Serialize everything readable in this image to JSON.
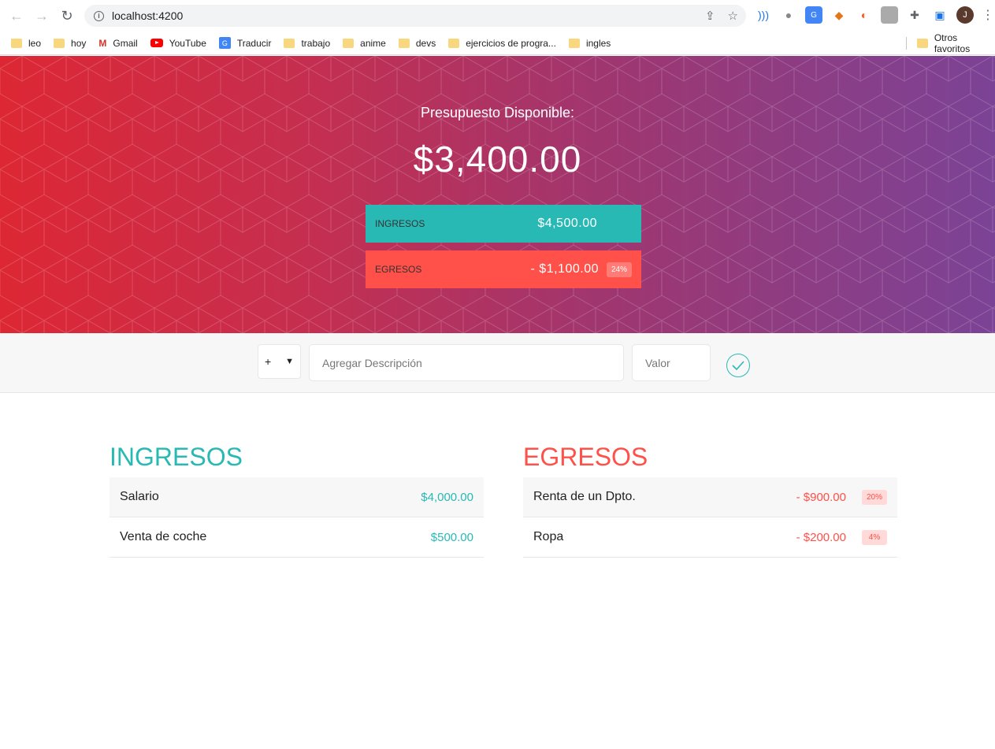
{
  "browser": {
    "url": "localhost:4200",
    "bookmarks": [
      "leo",
      "hoy",
      "Gmail",
      "YouTube",
      "Traducir",
      "trabajo",
      "anime",
      "devs",
      "ejercicios de progra...",
      "ingles"
    ],
    "other_bookmarks": "Otros favoritos",
    "avatar_letter": "J"
  },
  "hero": {
    "title": "Presupuesto Disponible:",
    "total": "$3,400.00",
    "income_label": "INGRESOS",
    "income_total": "$4,500.00",
    "expense_label": "EGRESOS",
    "expense_total": "- $1,100.00",
    "expense_pct": "24%"
  },
  "form": {
    "type_value": "+",
    "desc_placeholder": "Agregar Descripción",
    "value_placeholder": "Valor"
  },
  "income": {
    "title": "INGRESOS",
    "items": [
      {
        "desc": "Salario",
        "value": "$4,000.00"
      },
      {
        "desc": "Venta de coche",
        "value": "$500.00"
      }
    ]
  },
  "expenses": {
    "title": "EGRESOS",
    "items": [
      {
        "desc": "Renta de un Dpto.",
        "value": "- $900.00",
        "pct": "20%"
      },
      {
        "desc": "Ropa",
        "value": "- $200.00",
        "pct": "4%"
      }
    ]
  },
  "colors": {
    "income": "#28b9b5",
    "expense": "#ff5049"
  }
}
